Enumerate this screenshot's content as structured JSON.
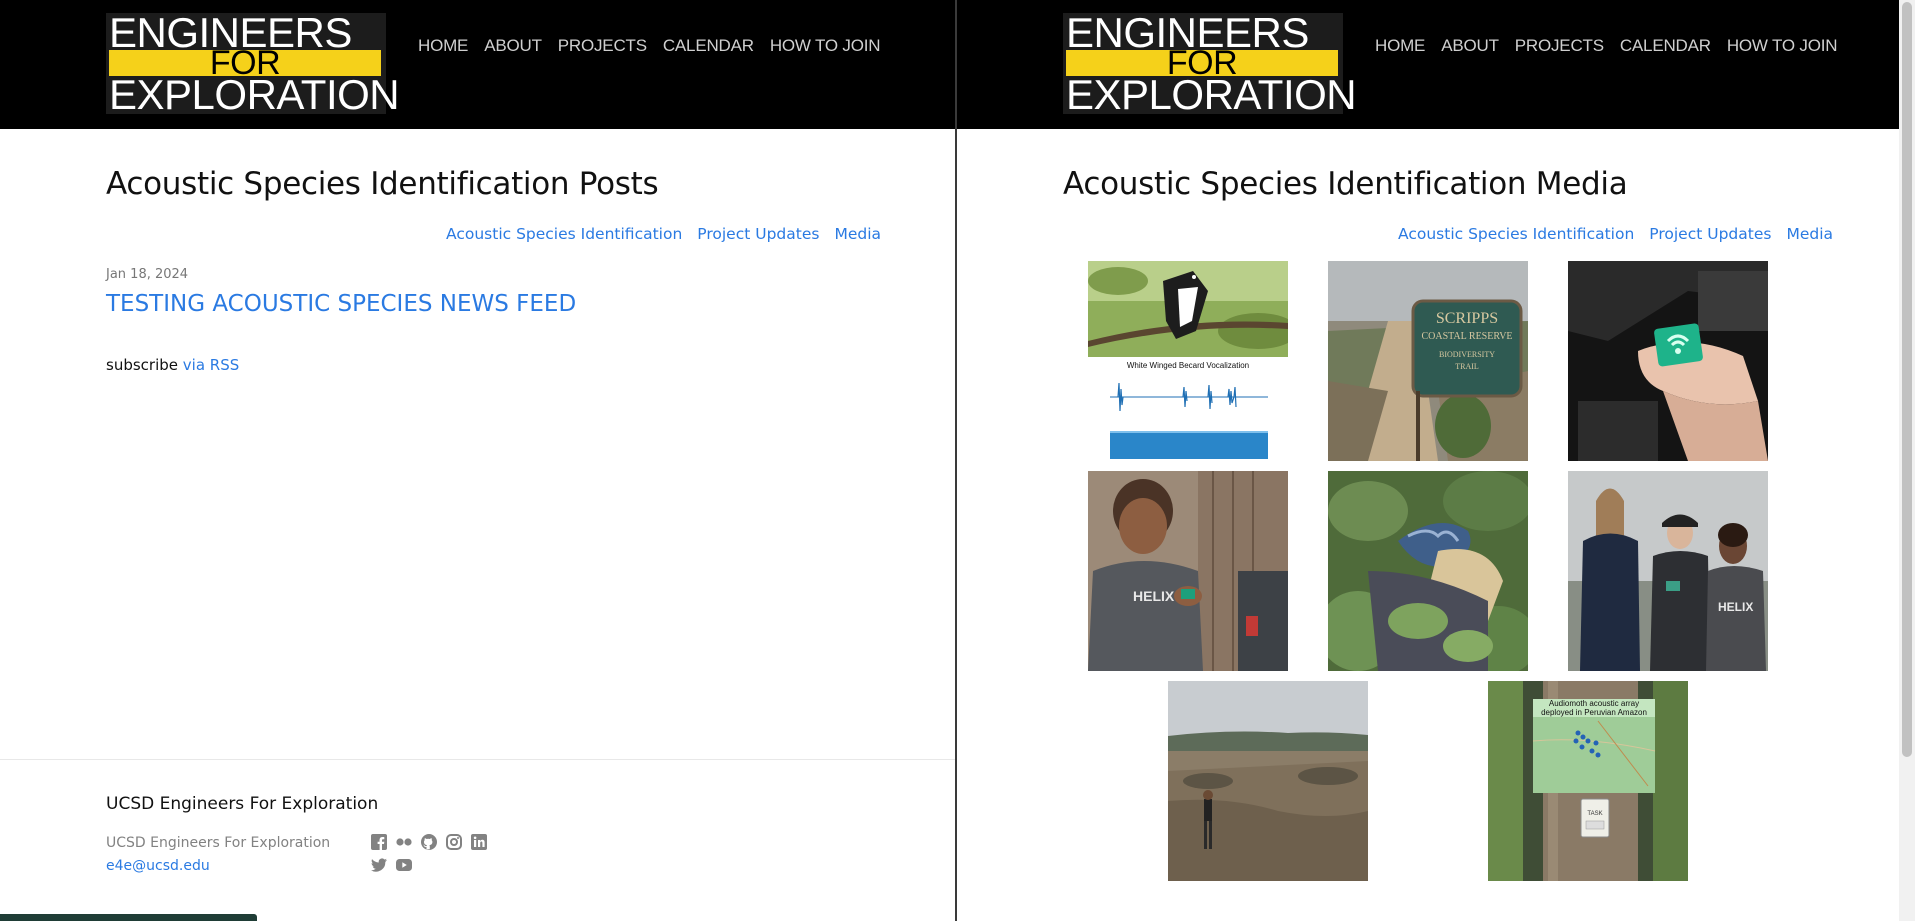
{
  "logo": {
    "line1": "ENGINEERS",
    "line2": "FOR",
    "line3": "EXPLORATION",
    "accent": "#f5d11a"
  },
  "nav": {
    "items": [
      "HOME",
      "ABOUT",
      "PROJECTS",
      "CALENDAR",
      "HOW TO JOIN"
    ]
  },
  "left": {
    "title": "Acoustic Species Identification Posts",
    "subnav": [
      "Acoustic Species Identification",
      "Project Updates",
      "Media"
    ],
    "post": {
      "date": "Jan 18, 2024",
      "title": "TESTING ACOUSTIC SPECIES NEWS FEED"
    },
    "subscribe": {
      "text": "subscribe",
      "link": "via RSS"
    },
    "footer": {
      "heading": "UCSD Engineers For Exploration",
      "name": "UCSD Engineers For Exploration",
      "email": "e4e@ucsd.edu",
      "social": [
        "facebook-icon",
        "flickr-icon",
        "github-icon",
        "instagram-icon",
        "linkedin-icon",
        "twitter-icon",
        "youtube-icon"
      ]
    }
  },
  "right": {
    "title": "Acoustic Species Identification Media",
    "subnav": [
      "Acoustic Species Identification",
      "Project Updates",
      "Media"
    ],
    "gallery": {
      "spectrogram_caption": "White Winged Becard Vocalization",
      "sign_text": [
        "SCRIPPS",
        "COASTAL RESERVE",
        "BIODIVERSITY",
        "TRAIL"
      ],
      "map_caption": [
        "Audiomoth acoustic array",
        "deployed in Peruvian Amazon"
      ],
      "tag_text": "TASK"
    }
  },
  "colors": {
    "link": "#2a7ae2",
    "header": "#000000",
    "progress": "#1f3d36"
  }
}
